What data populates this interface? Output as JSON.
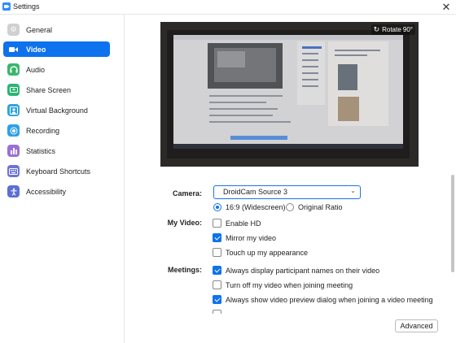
{
  "window": {
    "title": "Settings",
    "close": "✕"
  },
  "sidebar": {
    "items": [
      {
        "label": "General",
        "icon": "gear-icon",
        "color": "#cccccc",
        "glyph": "⚙"
      },
      {
        "label": "Video",
        "icon": "video-camera-icon",
        "color": "#0e72ed",
        "glyph": "■",
        "active": true
      },
      {
        "label": "Audio",
        "icon": "headphones-icon",
        "color": "#34b56a",
        "glyph": "♫"
      },
      {
        "label": "Share Screen",
        "icon": "share-screen-icon",
        "color": "#2bb673",
        "glyph": "▲"
      },
      {
        "label": "Virtual Background",
        "icon": "person-icon",
        "color": "#31a4d9",
        "glyph": "●"
      },
      {
        "label": "Recording",
        "icon": "record-icon",
        "color": "#2ea0e8",
        "glyph": "◉"
      },
      {
        "label": "Statistics",
        "icon": "bar-chart-icon",
        "color": "#9a6fd6",
        "glyph": "▮"
      },
      {
        "label": "Keyboard Shortcuts",
        "icon": "keyboard-icon",
        "color": "#6b74d6",
        "glyph": "▦"
      },
      {
        "label": "Accessibility",
        "icon": "accessibility-icon",
        "color": "#5b6fd6",
        "glyph": "♿"
      }
    ]
  },
  "preview": {
    "rotate_label": "Rotate 90°"
  },
  "camera": {
    "label": "Camera:",
    "selected": "DroidCam Source 3"
  },
  "aspect": {
    "widescreen": "16:9 (Widescreen)",
    "original": "Original Ratio",
    "selected": "widescreen"
  },
  "my_video": {
    "label": "My Video:",
    "options": [
      {
        "label": "Enable HD",
        "checked": false
      },
      {
        "label": "Mirror my video",
        "checked": true
      },
      {
        "label": "Touch up my appearance",
        "checked": false
      }
    ]
  },
  "meetings": {
    "label": "Meetings:",
    "options": [
      {
        "label": "Always display participant names on their video",
        "checked": true
      },
      {
        "label": "Turn off my video when joining meeting",
        "checked": false
      },
      {
        "label": "Always show video preview dialog when joining a video meeting",
        "checked": true
      }
    ]
  },
  "advanced_label": "Advanced"
}
